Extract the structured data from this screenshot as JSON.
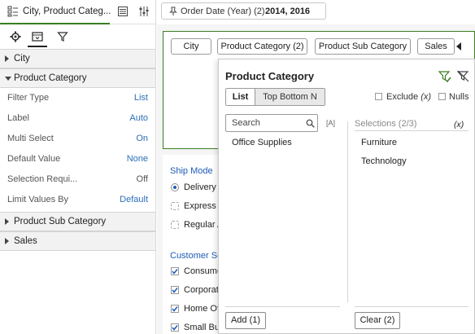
{
  "header": {
    "title": "City, Product Categ...",
    "icons": [
      "filter-list-icon",
      "list-view-icon",
      "filter-settings-icon"
    ]
  },
  "toolbar": {
    "icons": [
      "gear-icon",
      "tooltip-view-icon",
      "funnel-icon"
    ],
    "active": "tooltip-view-icon"
  },
  "sections": {
    "city": "City",
    "product_category": "Product Category",
    "product_sub_category": "Product Sub Category",
    "sales": "Sales"
  },
  "properties": [
    {
      "key": "Filter Type",
      "value": "List"
    },
    {
      "key": "Label",
      "value": "Auto"
    },
    {
      "key": "Multi Select",
      "value": "On"
    },
    {
      "key": "Default Value",
      "value": "None"
    },
    {
      "key": "Selection Requi...",
      "value": "Off"
    },
    {
      "key": "Limit Values By",
      "value": "Default"
    }
  ],
  "top_filter": {
    "label": "Order Date (Year) (2)",
    "value": "2014, 2016"
  },
  "chips": [
    "City",
    "Product Category (2)",
    "Product Sub Category",
    "Sales"
  ],
  "ship_mode": {
    "header": "Ship Mode",
    "items": [
      {
        "label": "Delivery T",
        "selected": true
      },
      {
        "label": "Express A",
        "selected": false
      },
      {
        "label": "Regular A",
        "selected": false
      }
    ]
  },
  "customer_segment": {
    "header": "Customer Se",
    "items": [
      {
        "label": "Consume",
        "checked": true
      },
      {
        "label": "Corporat",
        "checked": true
      },
      {
        "label": "Home Of",
        "checked": true
      },
      {
        "label": "Small Bu",
        "checked": true
      }
    ]
  },
  "popup": {
    "title": "Product Category",
    "tab_list": "List",
    "tab_top_bottom": "Top Bottom N",
    "exclude_label": "Exclude",
    "exclude_x": "(x)",
    "nulls_label": "Nulls",
    "search_placeholder": "Search",
    "sort_toggle": "[A]",
    "available": [
      "Office Supplies"
    ],
    "selections_header": "Selections (2/3)",
    "selections_x": "(x)",
    "selections": [
      "Furniture",
      "Technology"
    ],
    "add_button": "Add (1)",
    "clear_button": "Clear (2)"
  },
  "colors": {
    "accent_green": "#3b7d23",
    "link_blue": "#2a6ebb",
    "header_blue": "#1e5bb8"
  }
}
